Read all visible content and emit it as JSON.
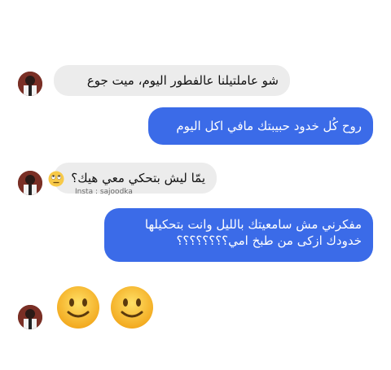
{
  "conversation": {
    "messages": [
      {
        "side": "incoming",
        "text": "شو عاملتيلنا عالفطور اليوم، ميت جوع"
      },
      {
        "side": "outgoing",
        "text": "روح كُل خدود حبيبتك مافي اكل اليوم"
      },
      {
        "side": "incoming",
        "text": "يمّا ليش بتحكي معي هيك؟",
        "emoji": "rolling-eyes"
      },
      {
        "side": "outgoing",
        "line1": "مفكرني مش سامعيتك بالليل وانت بتحكيلها",
        "line2": "خدودك ازكى من طبخ امي؟؟؟؟؟؟؟؟"
      },
      {
        "side": "incoming",
        "emoji": "slightly-smiling-face x2"
      }
    ],
    "watermark": "Insta : sajoodka"
  },
  "colors": {
    "incoming_bubble": "#ececec",
    "outgoing_bubble": "#3b6be8",
    "background": "#ffffff"
  }
}
